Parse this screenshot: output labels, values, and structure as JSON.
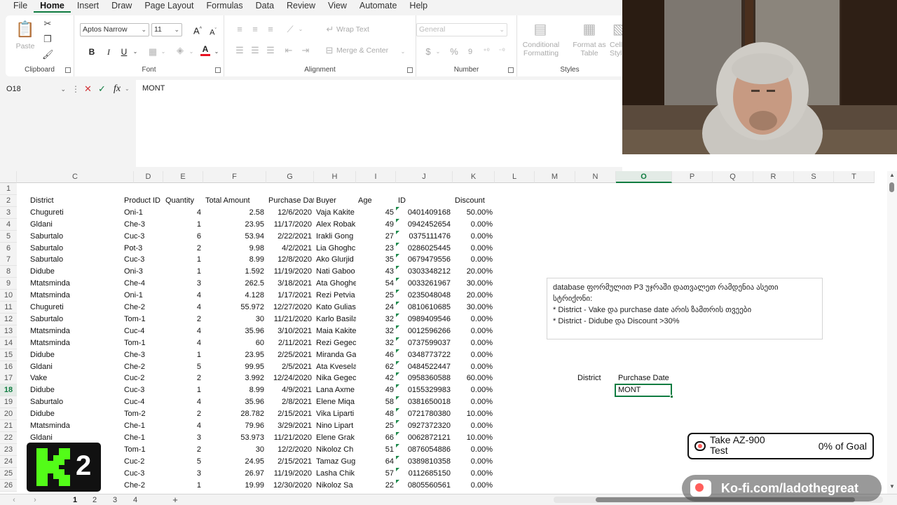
{
  "menu": {
    "items": [
      "File",
      "Home",
      "Insert",
      "Draw",
      "Page Layout",
      "Formulas",
      "Data",
      "Review",
      "View",
      "Automate",
      "Help"
    ],
    "active": "Home"
  },
  "ribbon": {
    "clipboard": {
      "paste": "Paste",
      "title": "Clipboard"
    },
    "font": {
      "name": "Aptos Narrow",
      "size": "11",
      "bold": "B",
      "italic": "I",
      "underline": "U",
      "grow": "A",
      "shrink": "A",
      "font_color_letter": "A",
      "title": "Font",
      "font_color": "#e81123"
    },
    "alignment": {
      "wrap": "Wrap Text",
      "merge": "Merge & Center",
      "title": "Alignment"
    },
    "number": {
      "format": "General",
      "currency": "$",
      "percent": "%",
      "comma": "9",
      "title": "Number"
    },
    "styles": {
      "conditional_1": "Conditional",
      "conditional_2": "Formatting",
      "format_table_1": "Format as",
      "format_table_2": "Table",
      "cell_1": "Cell",
      "cell_2": "Styles",
      "title": "Styles"
    }
  },
  "formula_bar": {
    "name_box": "O18",
    "cancel": "✕",
    "enter": "✓",
    "fx": "fx",
    "content": "MONT"
  },
  "grid": {
    "columns": [
      {
        "name": "C",
        "sel": false
      },
      {
        "name": "D",
        "sel": false
      },
      {
        "name": "E",
        "sel": false
      },
      {
        "name": "F",
        "sel": false
      },
      {
        "name": "G",
        "sel": false
      },
      {
        "name": "H",
        "sel": false
      },
      {
        "name": "I",
        "sel": false
      },
      {
        "name": "J",
        "sel": false
      },
      {
        "name": "K",
        "sel": false
      },
      {
        "name": "L",
        "sel": false
      },
      {
        "name": "M",
        "sel": false
      },
      {
        "name": "N",
        "sel": false
      },
      {
        "name": "O",
        "sel": true
      },
      {
        "name": "P",
        "sel": false
      },
      {
        "name": "Q",
        "sel": false
      },
      {
        "name": "R",
        "sel": false
      },
      {
        "name": "S",
        "sel": false
      },
      {
        "name": "T",
        "sel": false
      }
    ],
    "row_numbers": [
      "1",
      "2",
      "3",
      "4",
      "5",
      "6",
      "7",
      "8",
      "9",
      "10",
      "11",
      "12",
      "13",
      "14",
      "15",
      "16",
      "17",
      "18",
      "19",
      "20",
      "21",
      "22",
      "23",
      "24",
      "25",
      "26"
    ],
    "selected_row": "18",
    "headers": [
      "District",
      "Product ID",
      "Quantity",
      "Total Amount",
      "Purchase Date",
      "Buyer",
      "Age",
      "ID",
      "Discount"
    ],
    "rows": [
      [
        "Chugureti",
        "Oni-1",
        "4",
        "2.58",
        "12/6/2020",
        "Vaja Kakite",
        "45",
        "0401409168",
        "50.00%"
      ],
      [
        "Gldani",
        "Che-3",
        "1",
        "23.95",
        "11/17/2020",
        "Alex Robak",
        "49",
        "0942452654",
        "0.00%"
      ],
      [
        "Saburtalo",
        "Cuc-3",
        "6",
        "53.94",
        "2/22/2021",
        "Irakli Gong",
        "27",
        "0375111476",
        "0.00%"
      ],
      [
        "Saburtalo",
        "Pot-3",
        "2",
        "9.98",
        "4/2/2021",
        "Lia Ghoghc",
        "23",
        "0286025445",
        "0.00%"
      ],
      [
        "Saburtalo",
        "Cuc-3",
        "1",
        "8.99",
        "12/8/2020",
        "Ako Glurjid",
        "35",
        "0679479556",
        "0.00%"
      ],
      [
        "Didube",
        "Oni-3",
        "1",
        "1.592",
        "11/19/2020",
        "Nati Gaboo",
        "43",
        "0303348212",
        "20.00%"
      ],
      [
        "Mtatsminda",
        "Che-4",
        "3",
        "262.5",
        "3/18/2021",
        "Ata Ghoghe",
        "54",
        "0033261967",
        "30.00%"
      ],
      [
        "Mtatsminda",
        "Oni-1",
        "4",
        "4.128",
        "1/17/2021",
        "Rezi Petvia",
        "25",
        "0235048048",
        "20.00%"
      ],
      [
        "Chugureti",
        "Che-2",
        "4",
        "55.972",
        "12/27/2020",
        "Kato Gulias",
        "24",
        "0810610685",
        "30.00%"
      ],
      [
        "Saburtalo",
        "Tom-1",
        "2",
        "30",
        "11/21/2020",
        "Karlo Basila",
        "32",
        "0989409546",
        "0.00%"
      ],
      [
        "Mtatsminda",
        "Cuc-4",
        "4",
        "35.96",
        "3/10/2021",
        "Maia Kakite",
        "32",
        "0012596266",
        "0.00%"
      ],
      [
        "Mtatsminda",
        "Tom-1",
        "4",
        "60",
        "2/11/2021",
        "Rezi Gegec",
        "32",
        "0737599037",
        "0.00%"
      ],
      [
        "Didube",
        "Che-3",
        "1",
        "23.95",
        "2/25/2021",
        "Miranda Ga",
        "46",
        "0348773722",
        "0.00%"
      ],
      [
        "Gldani",
        "Che-2",
        "5",
        "99.95",
        "2/5/2021",
        "Ata Kvesela",
        "62",
        "0484522447",
        "0.00%"
      ],
      [
        "Vake",
        "Cuc-2",
        "2",
        "3.992",
        "12/24/2020",
        "Nika Gegec",
        "42",
        "0958360588",
        "60.00%"
      ],
      [
        "Didube",
        "Cuc-3",
        "1",
        "8.99",
        "4/9/2021",
        "Lana Axme",
        "49",
        "0155329983",
        "0.00%"
      ],
      [
        "Saburtalo",
        "Cuc-4",
        "4",
        "35.96",
        "2/8/2021",
        "Elene Miqa",
        "58",
        "0381650018",
        "0.00%"
      ],
      [
        "Didube",
        "Tom-2",
        "2",
        "28.782",
        "2/15/2021",
        "Vika Liparti",
        "48",
        "0721780380",
        "10.00%"
      ],
      [
        "Mtatsminda",
        "Che-1",
        "4",
        "79.96",
        "3/29/2021",
        "Nino Lipart",
        "25",
        "0927372320",
        "0.00%"
      ],
      [
        "Gldani",
        "Che-1",
        "3",
        "53.973",
        "11/21/2020",
        "Elene Grak",
        "66",
        "0062872121",
        "10.00%"
      ],
      [
        "",
        "Tom-1",
        "2",
        "30",
        "12/2/2020",
        "Nikoloz Ch",
        "51",
        "0876054886",
        "0.00%"
      ],
      [
        "",
        "Cuc-2",
        "5",
        "24.95",
        "2/15/2021",
        "Tamaz Gug",
        "64",
        "0389810358",
        "0.00%"
      ],
      [
        "",
        "Cuc-3",
        "3",
        "26.97",
        "11/19/2020",
        "Lasha Chik",
        "57",
        "0112685150",
        "0.00%"
      ],
      [
        "",
        "Che-2",
        "1",
        "19.99",
        "12/30/2020",
        "Nikoloz Sa",
        "22",
        "0805560561",
        "0.00%"
      ]
    ],
    "criteria": {
      "district_label": "District",
      "purchase_date_label": "Purchase Date",
      "active_value": "MONT"
    }
  },
  "note": {
    "lines": [
      "database ფორმულით P3 უჯრაში დათვალეთ  რამდენია ასეთი",
      "სტრიქონი:",
      "* District - Vake და purchase date არის ზამთრის თვეები",
      "* District - Didube და Discount >30%"
    ]
  },
  "sheet_tabs": [
    "1",
    "2",
    "3",
    "4"
  ],
  "sheet_tab_add": "+",
  "overlays": {
    "logo_text": "2",
    "goal_title_1": "Take AZ-900",
    "goal_title_2": "Test",
    "goal_progress": "0% of Goal",
    "goal_fraction": 0,
    "kofi_text": "Ko-fi.com/ladothegreat"
  },
  "colors": {
    "accent": "#107c41",
    "kofi_heart": "#ff5e5b",
    "logo_green": "#53fc18"
  }
}
